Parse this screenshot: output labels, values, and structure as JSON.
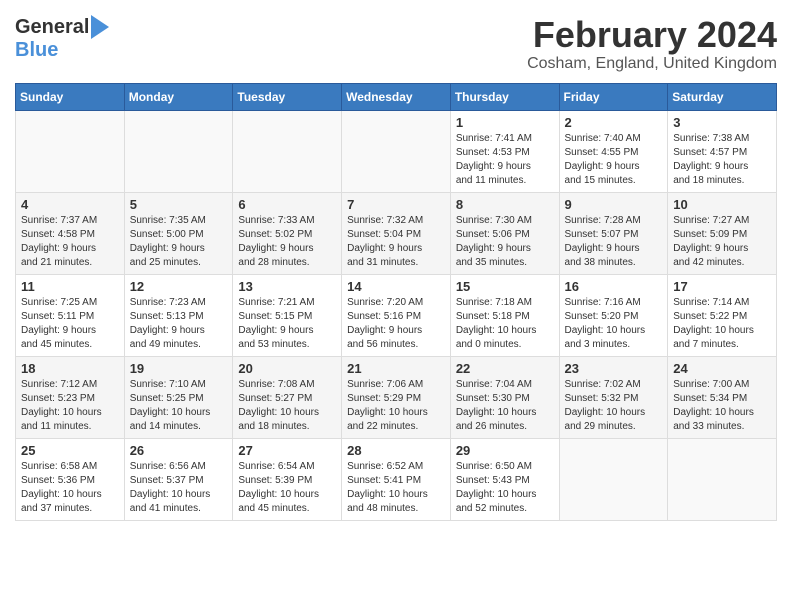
{
  "header": {
    "logo_general": "General",
    "logo_blue": "Blue",
    "month": "February 2024",
    "location": "Cosham, England, United Kingdom"
  },
  "weekdays": [
    "Sunday",
    "Monday",
    "Tuesday",
    "Wednesday",
    "Thursday",
    "Friday",
    "Saturday"
  ],
  "weeks": [
    [
      {
        "day": "",
        "info": ""
      },
      {
        "day": "",
        "info": ""
      },
      {
        "day": "",
        "info": ""
      },
      {
        "day": "",
        "info": ""
      },
      {
        "day": "1",
        "info": "Sunrise: 7:41 AM\nSunset: 4:53 PM\nDaylight: 9 hours\nand 11 minutes."
      },
      {
        "day": "2",
        "info": "Sunrise: 7:40 AM\nSunset: 4:55 PM\nDaylight: 9 hours\nand 15 minutes."
      },
      {
        "day": "3",
        "info": "Sunrise: 7:38 AM\nSunset: 4:57 PM\nDaylight: 9 hours\nand 18 minutes."
      }
    ],
    [
      {
        "day": "4",
        "info": "Sunrise: 7:37 AM\nSunset: 4:58 PM\nDaylight: 9 hours\nand 21 minutes."
      },
      {
        "day": "5",
        "info": "Sunrise: 7:35 AM\nSunset: 5:00 PM\nDaylight: 9 hours\nand 25 minutes."
      },
      {
        "day": "6",
        "info": "Sunrise: 7:33 AM\nSunset: 5:02 PM\nDaylight: 9 hours\nand 28 minutes."
      },
      {
        "day": "7",
        "info": "Sunrise: 7:32 AM\nSunset: 5:04 PM\nDaylight: 9 hours\nand 31 minutes."
      },
      {
        "day": "8",
        "info": "Sunrise: 7:30 AM\nSunset: 5:06 PM\nDaylight: 9 hours\nand 35 minutes."
      },
      {
        "day": "9",
        "info": "Sunrise: 7:28 AM\nSunset: 5:07 PM\nDaylight: 9 hours\nand 38 minutes."
      },
      {
        "day": "10",
        "info": "Sunrise: 7:27 AM\nSunset: 5:09 PM\nDaylight: 9 hours\nand 42 minutes."
      }
    ],
    [
      {
        "day": "11",
        "info": "Sunrise: 7:25 AM\nSunset: 5:11 PM\nDaylight: 9 hours\nand 45 minutes."
      },
      {
        "day": "12",
        "info": "Sunrise: 7:23 AM\nSunset: 5:13 PM\nDaylight: 9 hours\nand 49 minutes."
      },
      {
        "day": "13",
        "info": "Sunrise: 7:21 AM\nSunset: 5:15 PM\nDaylight: 9 hours\nand 53 minutes."
      },
      {
        "day": "14",
        "info": "Sunrise: 7:20 AM\nSunset: 5:16 PM\nDaylight: 9 hours\nand 56 minutes."
      },
      {
        "day": "15",
        "info": "Sunrise: 7:18 AM\nSunset: 5:18 PM\nDaylight: 10 hours\nand 0 minutes."
      },
      {
        "day": "16",
        "info": "Sunrise: 7:16 AM\nSunset: 5:20 PM\nDaylight: 10 hours\nand 3 minutes."
      },
      {
        "day": "17",
        "info": "Sunrise: 7:14 AM\nSunset: 5:22 PM\nDaylight: 10 hours\nand 7 minutes."
      }
    ],
    [
      {
        "day": "18",
        "info": "Sunrise: 7:12 AM\nSunset: 5:23 PM\nDaylight: 10 hours\nand 11 minutes."
      },
      {
        "day": "19",
        "info": "Sunrise: 7:10 AM\nSunset: 5:25 PM\nDaylight: 10 hours\nand 14 minutes."
      },
      {
        "day": "20",
        "info": "Sunrise: 7:08 AM\nSunset: 5:27 PM\nDaylight: 10 hours\nand 18 minutes."
      },
      {
        "day": "21",
        "info": "Sunrise: 7:06 AM\nSunset: 5:29 PM\nDaylight: 10 hours\nand 22 minutes."
      },
      {
        "day": "22",
        "info": "Sunrise: 7:04 AM\nSunset: 5:30 PM\nDaylight: 10 hours\nand 26 minutes."
      },
      {
        "day": "23",
        "info": "Sunrise: 7:02 AM\nSunset: 5:32 PM\nDaylight: 10 hours\nand 29 minutes."
      },
      {
        "day": "24",
        "info": "Sunrise: 7:00 AM\nSunset: 5:34 PM\nDaylight: 10 hours\nand 33 minutes."
      }
    ],
    [
      {
        "day": "25",
        "info": "Sunrise: 6:58 AM\nSunset: 5:36 PM\nDaylight: 10 hours\nand 37 minutes."
      },
      {
        "day": "26",
        "info": "Sunrise: 6:56 AM\nSunset: 5:37 PM\nDaylight: 10 hours\nand 41 minutes."
      },
      {
        "day": "27",
        "info": "Sunrise: 6:54 AM\nSunset: 5:39 PM\nDaylight: 10 hours\nand 45 minutes."
      },
      {
        "day": "28",
        "info": "Sunrise: 6:52 AM\nSunset: 5:41 PM\nDaylight: 10 hours\nand 48 minutes."
      },
      {
        "day": "29",
        "info": "Sunrise: 6:50 AM\nSunset: 5:43 PM\nDaylight: 10 hours\nand 52 minutes."
      },
      {
        "day": "",
        "info": ""
      },
      {
        "day": "",
        "info": ""
      }
    ]
  ]
}
